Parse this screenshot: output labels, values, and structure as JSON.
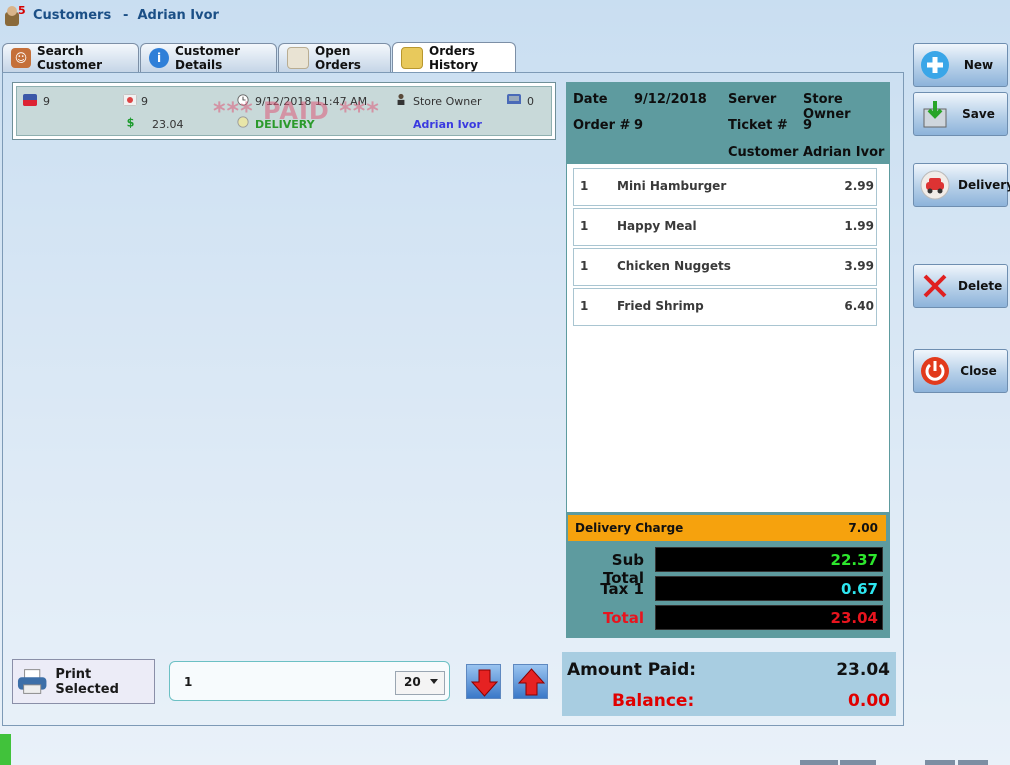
{
  "app": {
    "title": "Customers",
    "customer_separator": "-",
    "customer_name": "Adrian Ivor"
  },
  "tabs": [
    {
      "label": "Search Customer",
      "active": false
    },
    {
      "label": "Customer Details",
      "active": false
    },
    {
      "label": "Open Orders",
      "active": false
    },
    {
      "label": "Orders History",
      "active": true
    }
  ],
  "order_card": {
    "order_number": "9",
    "ticket_number": "9",
    "datetime": "9/12/2018 11:47 AM",
    "server": "Store Owner",
    "station": "0",
    "amount": "23.04",
    "type": "DELIVERY",
    "customer": "Adrian Ivor",
    "stamp": "*** PAID ***"
  },
  "order_detail": {
    "date_label": "Date",
    "date_value": "9/12/2018",
    "server_label": "Server",
    "server_value": "Store Owner",
    "order_label": "Order #",
    "order_value": "9",
    "ticket_label": "Ticket #",
    "ticket_value": "9",
    "customer_label": "Customer",
    "customer_value": "Adrian Ivor",
    "items": [
      {
        "qty": "1",
        "name": "Mini Hamburger",
        "price": "2.99"
      },
      {
        "qty": "1",
        "name": "Happy Meal",
        "price": "1.99"
      },
      {
        "qty": "1",
        "name": "Chicken Nuggets",
        "price": "3.99"
      },
      {
        "qty": "1",
        "name": "Fried Shrimp",
        "price": "6.40"
      }
    ],
    "delivery_label": "Delivery Charge",
    "delivery_value": "7.00",
    "subtotal_label": "Sub Total",
    "subtotal_value": "22.37",
    "tax_label": "Tax 1",
    "tax_value": "0.67",
    "total_label": "Total",
    "total_value": "23.04"
  },
  "payment": {
    "amount_paid_label": "Amount Paid:",
    "amount_paid_value": "23.04",
    "balance_label": "Balance:",
    "balance_value": "0.00"
  },
  "controls": {
    "print_label": "Print Selected",
    "page_value": "1",
    "page_size": "20"
  },
  "actions": {
    "new": "New",
    "save": "Save",
    "delivery": "Delivery",
    "delete": "Delete",
    "close": "Close"
  },
  "colors": {
    "header_teal": "#5e9b9f",
    "delivery_orange": "#f6a20d",
    "subtotal_green": "#2de62d",
    "tax_cyan": "#2ee6f0",
    "total_red": "#e8141e",
    "balance_red": "#e00000"
  }
}
